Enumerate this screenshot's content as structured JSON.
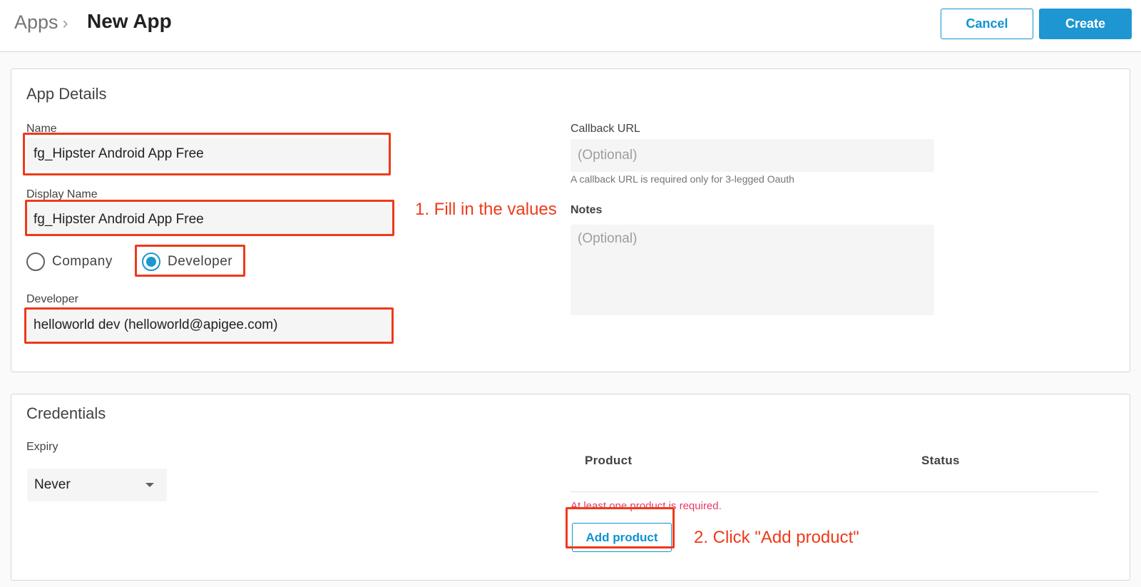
{
  "header": {
    "breadcrumb": "Apps",
    "title": "New App",
    "cancel_label": "Cancel",
    "create_label": "Create"
  },
  "app_details": {
    "title": "App Details",
    "name_label": "Name",
    "name_value": "fg_Hipster Android App Free",
    "display_name_label": "Display Name",
    "display_name_value": "fg_Hipster Android App Free",
    "owner_options": [
      {
        "label": "Company",
        "selected": false
      },
      {
        "label": "Developer",
        "selected": true
      }
    ],
    "developer_label": "Developer",
    "developer_value": "helloworld dev (helloworld@apigee.com)",
    "callback_label": "Callback URL",
    "callback_placeholder": "(Optional)",
    "callback_hint": "A callback URL is required only for 3-legged Oauth",
    "notes_label": "Notes",
    "notes_placeholder": "(Optional)"
  },
  "credentials": {
    "title": "Credentials",
    "expiry_label": "Expiry",
    "expiry_value": "Never",
    "table_headers": [
      "Product",
      "Status"
    ],
    "error_text": "At least one product is required.",
    "add_product_label": "Add product"
  },
  "annotations": {
    "step1": "1. Fill in the values",
    "step2": "2. Click \"Add product\"",
    "highlight_color": "#ee3a1a"
  },
  "colors": {
    "accent": "#1d96d1",
    "error": "#e53967"
  }
}
